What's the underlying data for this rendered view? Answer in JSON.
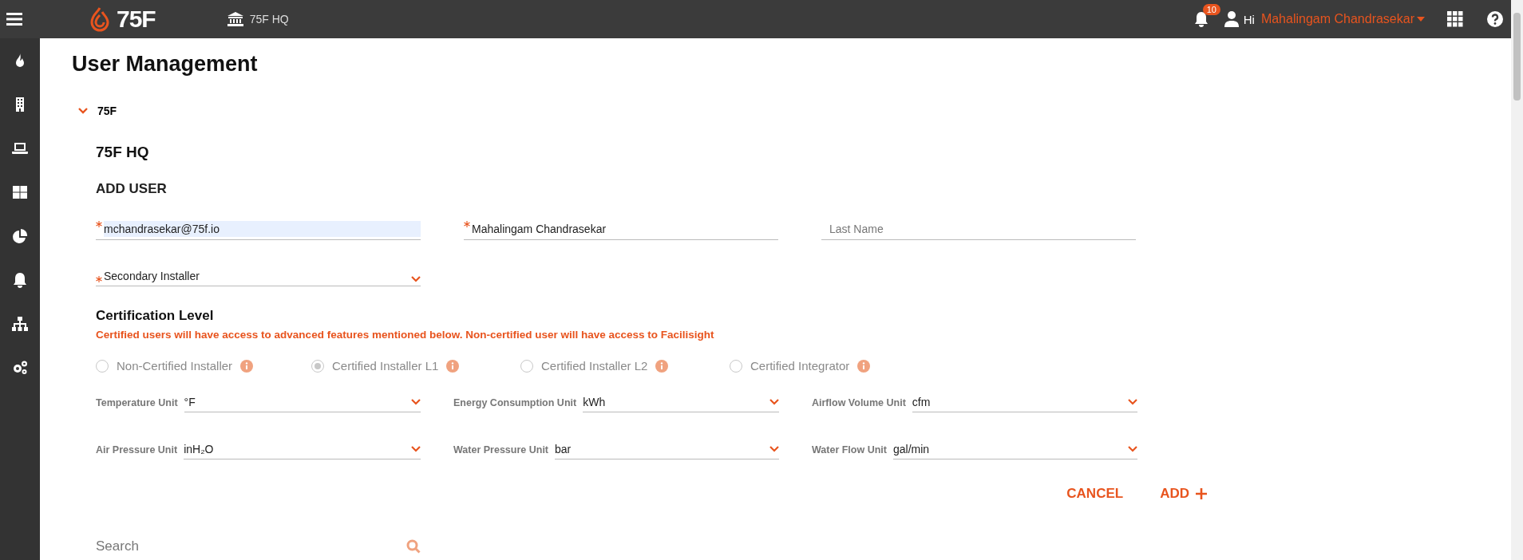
{
  "top_bar": {
    "logo_text": "75F",
    "site": "75F HQ",
    "notification_count": "10",
    "greeting": "Hi",
    "user_name": "Mahalingam Chandrasekar"
  },
  "page": {
    "title": "User Management",
    "tree": {
      "label": "75F",
      "expanded": true
    },
    "site_title": "75F HQ",
    "section": "ADD USER",
    "fields": [
      {
        "value": "mchandrasekar@75f.io",
        "required": true,
        "autofilled": true
      },
      {
        "value": "Mahalingam Chandrasekar",
        "required": true,
        "autofilled": false
      },
      {
        "placeholder": "Last Name",
        "required": false,
        "autofilled": false
      }
    ],
    "role": {
      "value": "Secondary Installer",
      "required": true
    },
    "certification": {
      "heading": "Certification Level",
      "notice": "Certified users will have access to advanced features mentioned below. Non-certified user will have access to Facilisight",
      "options": [
        {
          "label": "Non-Certified Installer",
          "selected": false,
          "disabled": true
        },
        {
          "label": "Certified Installer L1",
          "selected": true,
          "disabled": true
        },
        {
          "label": "Certified Installer L2",
          "selected": false,
          "disabled": true
        },
        {
          "label": "Certified Integrator",
          "selected": false,
          "disabled": true
        }
      ]
    },
    "units": [
      {
        "label": "Temperature Unit",
        "value": "°F"
      },
      {
        "label": "Energy Consumption Unit",
        "value": "kWh"
      },
      {
        "label": "Airflow Volume Unit",
        "value": "cfm"
      },
      {
        "label": "Air Pressure Unit",
        "value": "inH₂O"
      },
      {
        "label": "Water Pressure Unit",
        "value": "bar"
      },
      {
        "label": "Water Flow Unit",
        "value": "gal/min"
      }
    ],
    "actions": [
      {
        "label": "CANCEL",
        "kind": "cancel"
      },
      {
        "label": "ADD",
        "kind": "add"
      }
    ],
    "search": {
      "placeholder": "Search"
    }
  }
}
